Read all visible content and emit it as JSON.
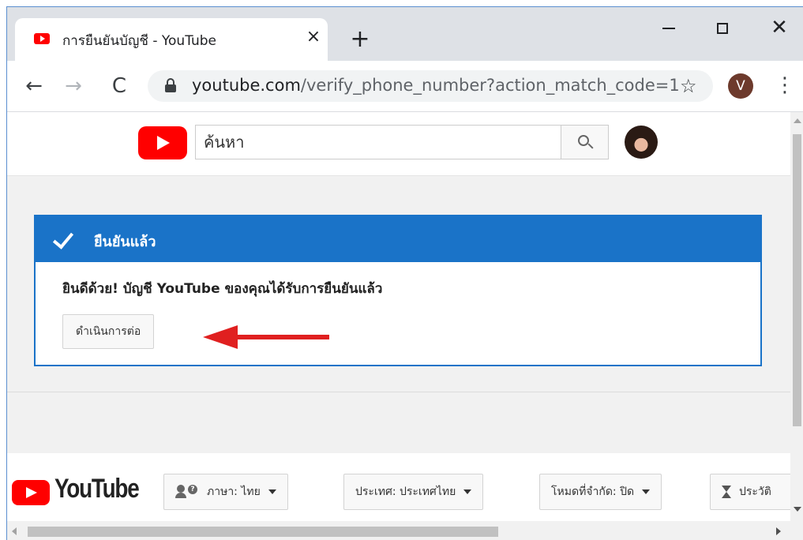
{
  "browser": {
    "tab": {
      "title": "การยืนยันบัญชี - YouTube",
      "close_glyph": "×"
    },
    "new_tab_glyph": "+",
    "window_close_glyph": "✕",
    "nav": {
      "back_glyph": "←",
      "forward_glyph": "→",
      "reload_glyph": "C"
    },
    "address": {
      "host": "youtube.com",
      "path": "/verify_phone_number?action_match_code=1"
    },
    "star_glyph": "☆",
    "profile_initial": "V",
    "menu_glyph": "⋮"
  },
  "masthead": {
    "search_placeholder": "ค้นหา"
  },
  "verification": {
    "title": "ยืนยันแล้ว",
    "message": "ยินดีด้วย! บัญชี YouTube ของคุณได้รับการยืนยันแล้ว",
    "continue_label": "ดำเนินการต่อ",
    "annotation_color": "#e02020"
  },
  "footer": {
    "logo_text": "YouTube",
    "language_label": "ภาษา: ไทย",
    "country_label": "ประเทศ: ประเทศไทย",
    "restricted_mode_label": "โหมดที่จำกัด: ปิด",
    "history_label": "ประวัติ"
  },
  "colors": {
    "brand_red": "#ff0000",
    "card_blue": "#1a73c8"
  }
}
